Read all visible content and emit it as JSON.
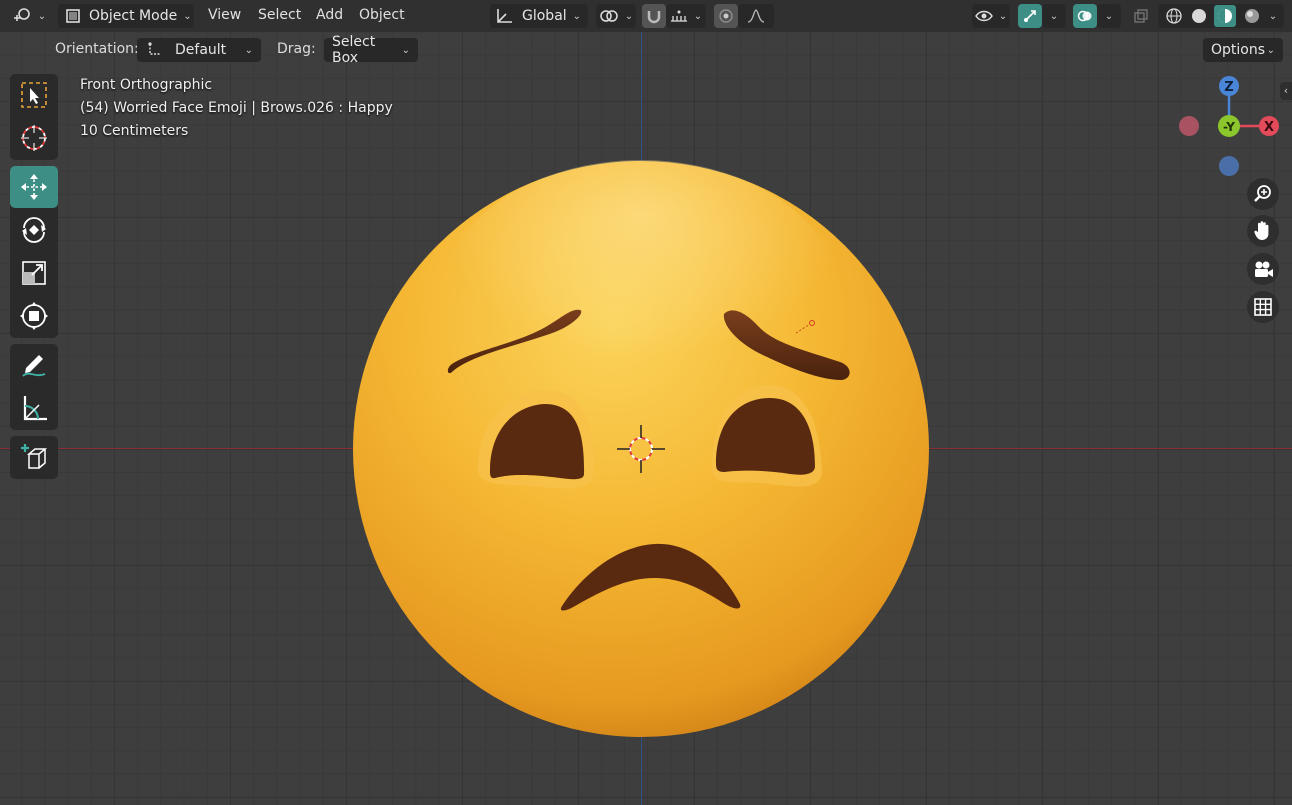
{
  "header": {
    "editor_type_icon": "editor-type-icon",
    "mode_label": "Object Mode",
    "menus": [
      "View",
      "Select",
      "Add",
      "Object"
    ],
    "transform_orientation": "Global",
    "options_label": "Options"
  },
  "tool_settings": {
    "orientation_label": "Orientation:",
    "orientation_value": "Default",
    "drag_label": "Drag:",
    "drag_value": "Select Box"
  },
  "viewport_info": {
    "view_name": "Front Orthographic",
    "object_info": "(54) Worried Face Emoji | Brows.026 : Happy",
    "grid_scale": "10 Centimeters"
  },
  "gizmo": {
    "z_label": "Z",
    "y_label": "-Y",
    "x_label": "X",
    "colors": {
      "x": "#e34b5a",
      "y": "#8ac62c",
      "z": "#4a86d8"
    }
  },
  "toolbar": {
    "tools": [
      "select-box-icon",
      "cursor-icon",
      "move-icon",
      "rotate-icon",
      "scale-icon",
      "transform-icon",
      "annotate-icon",
      "measure-icon",
      "add-cube-icon"
    ],
    "active_tool": "move-icon"
  },
  "colors": {
    "accent": "#3d8f86",
    "emoji_yellow": "#f4b23a",
    "feature_brown": "#5a2c12"
  }
}
